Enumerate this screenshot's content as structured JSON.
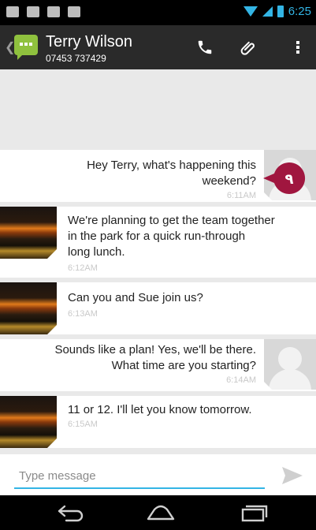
{
  "status_bar": {
    "time": "6:25"
  },
  "action_bar": {
    "contact_name": "Terry Wilson",
    "contact_number": "07453 737429",
    "icons": [
      "back-caret-icon",
      "messaging-app-icon",
      "phone-icon",
      "paperclip-icon",
      "overflow-menu-icon"
    ]
  },
  "conversation": {
    "messages": [
      {
        "direction": "out",
        "lines": [
          "Hey Terry, what's happening this",
          "weekend?"
        ],
        "time": "6:11AM"
      },
      {
        "direction": "in",
        "lines": [
          "We're planning to get the team together",
          "in the park for a quick run-through",
          "long lunch."
        ],
        "time": "6:12AM"
      },
      {
        "direction": "in",
        "lines": [
          "Can you and Sue join us?"
        ],
        "time": "6:13AM"
      },
      {
        "direction": "out",
        "lines": [
          "Sounds like a plan! Yes, we'll be there.",
          "What time are you starting?"
        ],
        "time": "6:14AM"
      },
      {
        "direction": "in",
        "lines": [
          "11 or 12. I'll let you know tomorrow."
        ],
        "time": "6:15AM"
      }
    ],
    "marker_label": "٩"
  },
  "compose": {
    "placeholder": "Type message"
  },
  "colors": {
    "accent": "#33b5e5",
    "action_bar": "#2a2a2a",
    "marker": "#a0163f",
    "app_icon": "#8fc13e"
  }
}
